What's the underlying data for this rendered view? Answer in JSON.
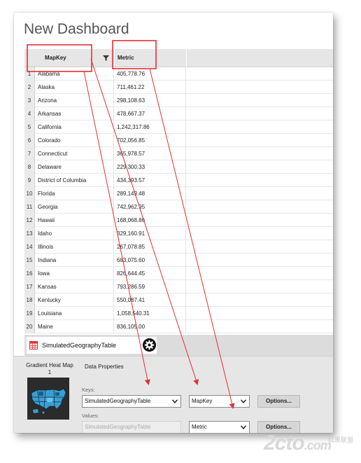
{
  "page": {
    "title": "New Dashboard"
  },
  "table": {
    "columns": [
      "MapKey",
      "Metric"
    ],
    "rows": [
      {
        "n": "1",
        "key": "Alabama",
        "metric": "405,778.76"
      },
      {
        "n": "2",
        "key": "Alaska",
        "metric": "711,461.22"
      },
      {
        "n": "3",
        "key": "Arizona",
        "metric": "298,108.63"
      },
      {
        "n": "4",
        "key": "Arkansas",
        "metric": "478,667.37"
      },
      {
        "n": "5",
        "key": "California",
        "metric": "1,242,317.86"
      },
      {
        "n": "6",
        "key": "Colorado",
        "metric": "702,056.85"
      },
      {
        "n": "7",
        "key": "Connecticut",
        "metric": "365,978.57"
      },
      {
        "n": "8",
        "key": "Delaware",
        "metric": "229,300.33"
      },
      {
        "n": "9",
        "key": "District of Columbia",
        "metric": "434,393.57"
      },
      {
        "n": "10",
        "key": "Florida",
        "metric": "289,149.48"
      },
      {
        "n": "11",
        "key": "Georgia",
        "metric": "742,962.95"
      },
      {
        "n": "12",
        "key": "Hawaii",
        "metric": "168,068.86"
      },
      {
        "n": "13",
        "key": "Idaho",
        "metric": "329,160.91"
      },
      {
        "n": "14",
        "key": "Illinois",
        "metric": "267,078.85"
      },
      {
        "n": "15",
        "key": "Indiana",
        "metric": "683,075.60"
      },
      {
        "n": "16",
        "key": "Iowa",
        "metric": "826,644.45"
      },
      {
        "n": "17",
        "key": "Kansas",
        "metric": "793,286.59"
      },
      {
        "n": "18",
        "key": "Kentucky",
        "metric": "550,087.41"
      },
      {
        "n": "19",
        "key": "Louisiana",
        "metric": "1,058,540.31"
      },
      {
        "n": "20",
        "key": "Maine",
        "metric": "836,105.00"
      }
    ]
  },
  "tab": {
    "label": "SimulatedGeographyTable",
    "icon": "table-icon",
    "settings_icon": "gear-icon"
  },
  "panel": {
    "visualization_label": "Gradient Heat Map 1",
    "section_title": "Data Properties",
    "keys_label": "Keys:",
    "keys_table": "SimulatedGeographyTable",
    "keys_column": "MapKey",
    "values_label": "Values:",
    "values_table": "SimulatedGeographyTable",
    "values_column": "Metric",
    "options_label": "Options..."
  },
  "watermark": {
    "text": "2cto",
    "suffix": ".com",
    "cn": "红黑联盟"
  },
  "colors": {
    "annotation": "#e53030",
    "header_bg": "#e6e6e6",
    "panel_bg": "#e6e6e6"
  }
}
